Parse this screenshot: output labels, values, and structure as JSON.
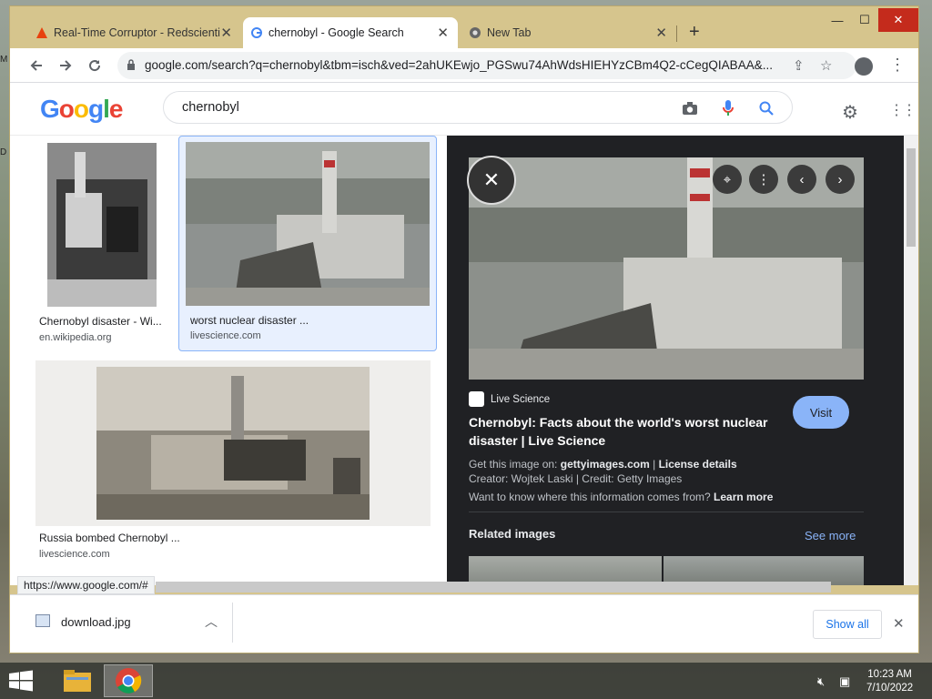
{
  "browser": {
    "tabs": [
      {
        "title": "Real-Time Corruptor - Redscienti",
        "icon": "warning-triangle-icon"
      },
      {
        "title": "chernobyl - Google Search",
        "icon": "google-g-icon"
      },
      {
        "title": "New Tab",
        "icon": "chrome-icon"
      }
    ],
    "new_tab_symbol": "+",
    "window_controls": {
      "minimize": "—",
      "maximize": "☐",
      "close": "✕"
    },
    "url": "google.com/search?q=chernobyl&tbm=isch&ved=2ahUKEwjo_PGSwu74AhWdsHIEHYzCBm4Q2-cCegQIABAA&..."
  },
  "google": {
    "logo": [
      "G",
      "o",
      "o",
      "g",
      "l",
      "e"
    ],
    "logo_colors": [
      "#4285f4",
      "#ea4335",
      "#fbbc05",
      "#4285f4",
      "#34a853",
      "#ea4335"
    ],
    "query": "chernobyl"
  },
  "results": [
    {
      "title": "Chernobyl disaster - Wi...",
      "source": "en.wikipedia.org"
    },
    {
      "title": "worst nuclear disaster ...",
      "source": "livescience.com"
    },
    {
      "title": "Russia bombed Chernobyl ...",
      "source": "livescience.com"
    }
  ],
  "panel": {
    "source_name": "Live Science",
    "visit_label": "Visit",
    "title": "Chernobyl: Facts about the world's worst nuclear disaster | Live Science",
    "get_image_prefix": "Get this image on:",
    "get_image_site": "gettyimages.com",
    "license_sep": "|",
    "license_label": "License details",
    "creator_line": "Creator: Wojtek Laski | Credit: Getty Images",
    "info_prefix": "Want to know where this information comes from?",
    "learn_more": "Learn more",
    "related_title": "Related images",
    "see_more": "See more"
  },
  "status_url": "https://www.google.com/#",
  "downloads": {
    "file_name": "download.jpg",
    "show_all": "Show all"
  },
  "taskbar": {
    "time": "10:23 AM",
    "date": "7/10/2022"
  }
}
